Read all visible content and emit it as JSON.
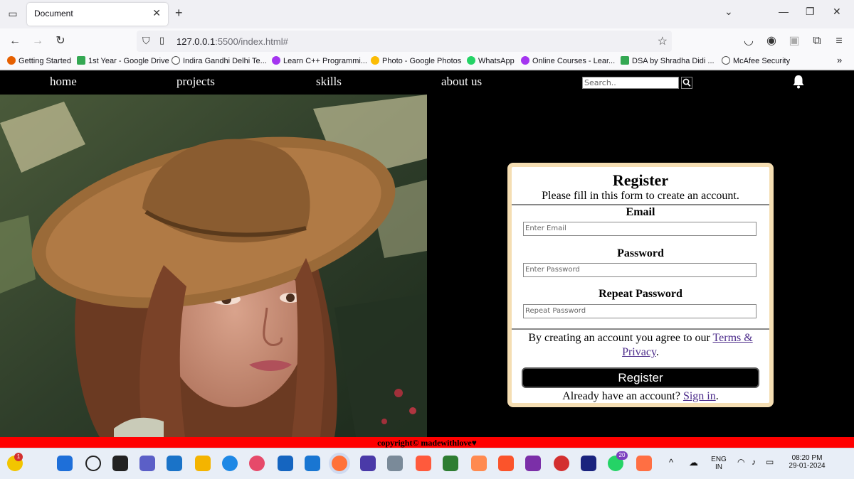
{
  "browser": {
    "tab_title": "Document",
    "url_host": "127.0.0.1",
    "url_rest": ":5500/index.html#",
    "bookmarks": [
      "Getting Started",
      "1st Year - Google Drive",
      "Indira Gandhi Delhi Te...",
      "Learn C++ Programmi...",
      "Photo - Google Photos",
      "WhatsApp",
      "Online Courses - Lear...",
      "DSA by Shradha Didi ...",
      "McAfee Security"
    ]
  },
  "site": {
    "nav": [
      "home",
      "projects",
      "skills",
      "about us"
    ],
    "search_placeholder": "Search..",
    "footer": "copyright© madewithlove♥"
  },
  "form": {
    "title": "Register",
    "subtitle": "Please fill in this form to create an account.",
    "email_label": "Email",
    "email_placeholder": "Enter Email",
    "password_label": "Password",
    "password_placeholder": "Enter Password",
    "repeat_label": "Repeat Password",
    "repeat_placeholder": "Repeat Password",
    "terms_text": "By creating an account you agree to our ",
    "terms_link": "Terms & Privacy",
    "register_button": "Register",
    "signin_text": "Already have an account? ",
    "signin_link": "Sign in"
  },
  "taskbar": {
    "lang_top": "ENG",
    "lang_bottom": "IN",
    "time": "08:20 PM",
    "date": "29-01-2024",
    "whatsapp_badge": "20",
    "notification_badge": "1"
  },
  "colors": {
    "card_border": "#f5deb3",
    "footer_bg": "#ff0000",
    "link": "#4b2a8a"
  }
}
